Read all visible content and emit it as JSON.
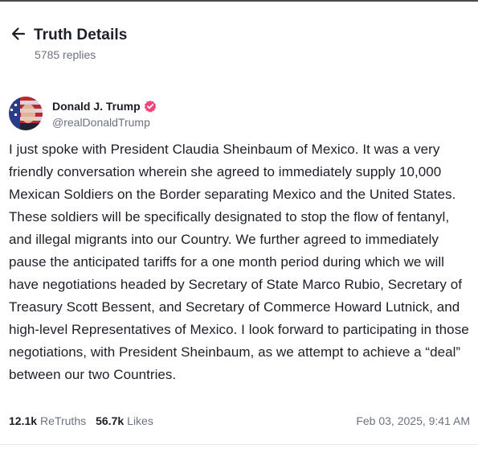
{
  "header": {
    "title": "Truth Details",
    "replies": "5785 replies"
  },
  "icons": {
    "back": "arrow-left-icon",
    "verified": "verified-badge-icon"
  },
  "colors": {
    "verified_badge": "#f0467a",
    "muted_text": "#6b7280",
    "primary_text": "#1b1f27"
  },
  "post": {
    "author_name": "Donald J. Trump",
    "author_handle": "@realDonaldTrump",
    "text": "I just spoke with President Claudia Sheinbaum of Mexico. It was a very friendly conversation wherein she agreed to immediately supply 10,000 Mexican Soldiers on the Border separating Mexico and the United States. These soldiers will be specifically designated to stop the flow of fentanyl, and illegal migrants into our Country. We further agreed to immediately pause the anticipated tariffs for a one month period during which we will have negotiations headed by Secretary of State Marco Rubio, Secretary of Treasury Scott Bessent, and Secretary of Commerce Howard Lutnick, and high-level Representatives of Mexico. I look forward to participating in those negotiations, with President Sheinbaum, as we attempt to achieve a “deal” between our two Countries.",
    "retruths_count": "12.1k",
    "retruths_label": "ReTruths",
    "likes_count": "56.7k",
    "likes_label": "Likes",
    "timestamp": "Feb 03, 2025, 9:41 AM"
  }
}
